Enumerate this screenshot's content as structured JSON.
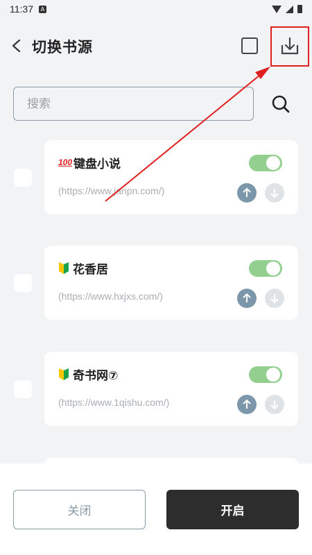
{
  "status_bar": {
    "time": "11:37",
    "notification_letter": "A"
  },
  "header": {
    "title": "切换书源"
  },
  "search": {
    "placeholder": "搜索"
  },
  "sources": [
    {
      "badge": "100",
      "badge_icon": "hundred-points-emoji",
      "name": "键盘小说",
      "url": "(https://www.janpn.com/)",
      "enabled": true
    },
    {
      "badge_icon": "beginner-leaf-emoji",
      "name": "花香居",
      "url": "(https://www.hxjxs.com/)",
      "enabled": true
    },
    {
      "badge_icon": "beginner-leaf-emoji",
      "name": "奇书网⑦",
      "url": "(https://www.1qishu.com/)",
      "enabled": true
    }
  ],
  "footer": {
    "close_label": "关闭",
    "enable_label": "开启"
  },
  "colors": {
    "toggle_on": "#93d08f",
    "highlight_box": "#e02020",
    "primary_button": "#2d2d2d",
    "up_button": "#7c97aa"
  }
}
